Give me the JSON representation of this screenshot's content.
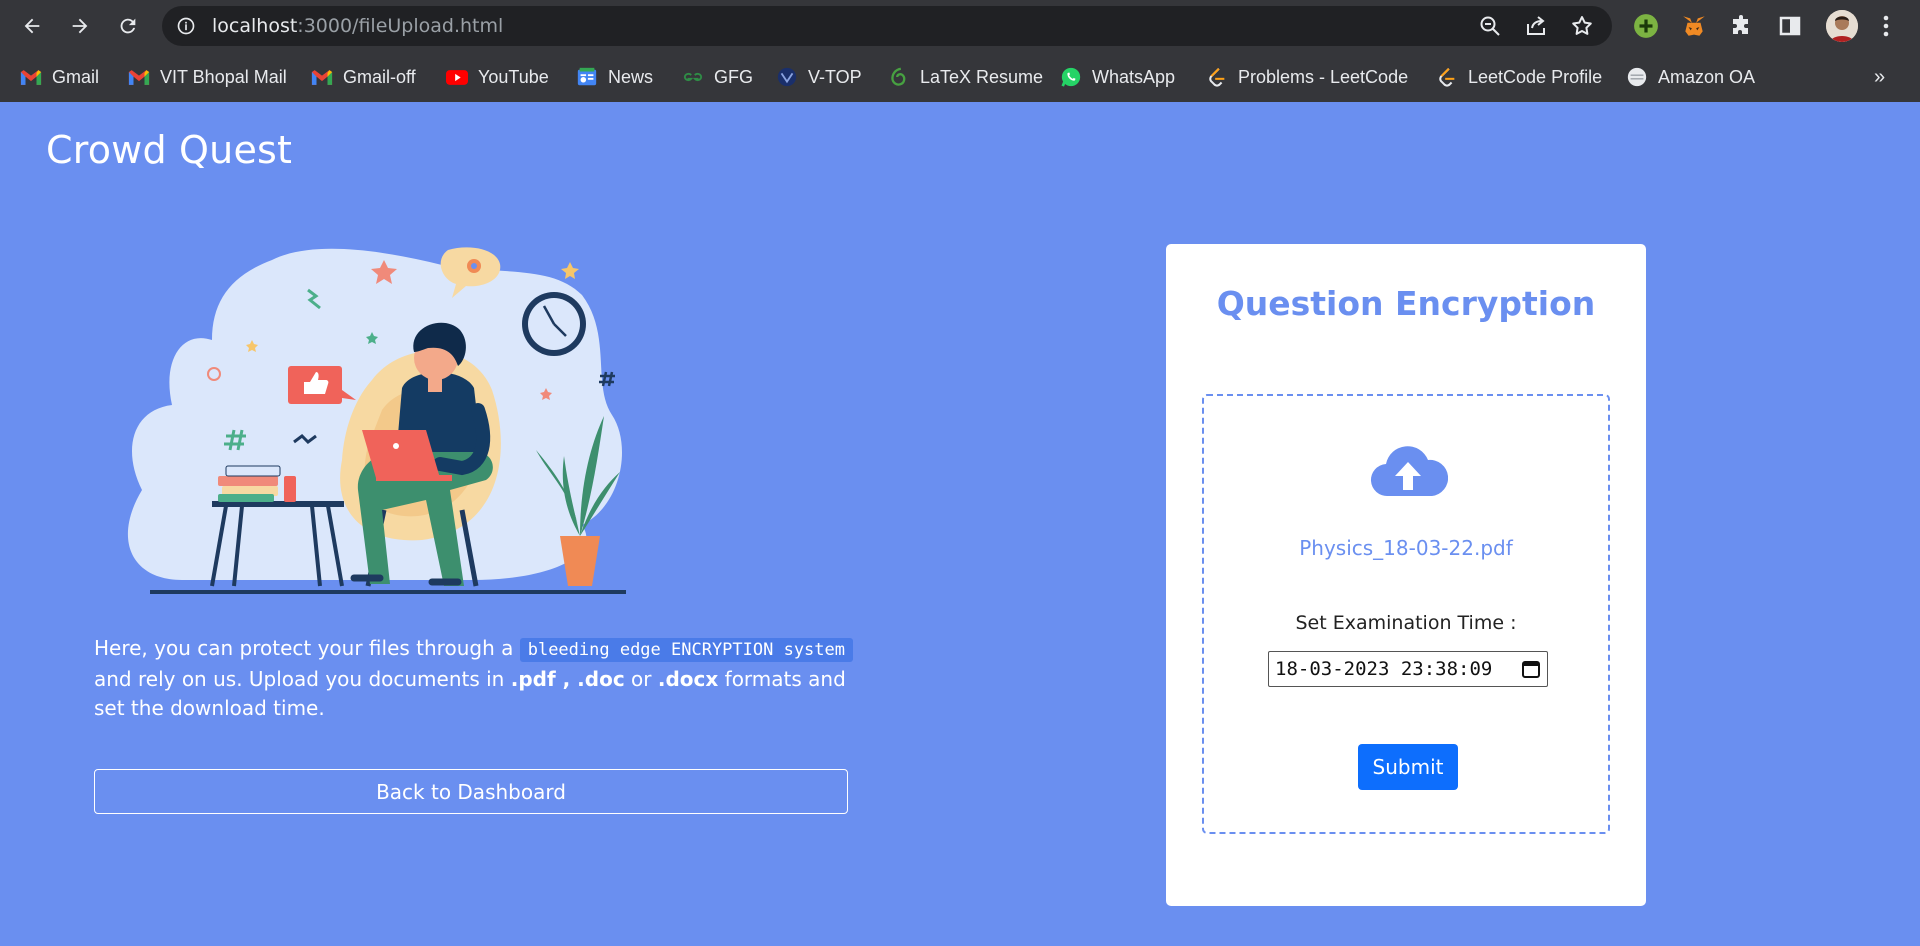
{
  "browser": {
    "url_host": "localhost",
    "url_path": ":3000/fileUpload.html",
    "bookmarks": [
      {
        "label": "Gmail",
        "icon": "gmail-icon"
      },
      {
        "label": "VIT Bhopal Mail",
        "icon": "gmail-icon"
      },
      {
        "label": "Gmail-off",
        "icon": "gmail-icon"
      },
      {
        "label": "YouTube",
        "icon": "youtube-icon"
      },
      {
        "label": "News",
        "icon": "google-news-icon"
      },
      {
        "label": "GFG",
        "icon": "geeksforgeeks-icon"
      },
      {
        "label": "V-TOP",
        "icon": "vtop-icon"
      },
      {
        "label": "LaTeX Resume",
        "icon": "overleaf-icon"
      },
      {
        "label": "WhatsApp",
        "icon": "whatsapp-icon"
      },
      {
        "label": "Problems - LeetCode",
        "icon": "leetcode-icon"
      },
      {
        "label": "LeetCode Profile",
        "icon": "leetcode-icon"
      },
      {
        "label": "Amazon OA",
        "icon": "globe-icon"
      }
    ],
    "more_bookmarks": "»"
  },
  "page": {
    "brand": "Crowd Quest",
    "description": {
      "part1": "Here, you can protect your files through a ",
      "code": "bleeding edge ENCRYPTION system",
      "part2": " and rely on us. Upload you documents in ",
      "fmt1": ".pdf , .doc",
      "part3": " or ",
      "fmt2": ".docx",
      "part4": " formats and set the download time."
    },
    "back_button": "Back to Dashboard"
  },
  "card": {
    "title": "Question Encryption",
    "file_name": "Physics_18-03-22.pdf",
    "time_label": "Set Examination Time :",
    "datetime_value": "18-03-2023 23:38:09",
    "submit": "Submit"
  },
  "colors": {
    "page_bg": "#6a8ff0",
    "accent": "#6a8ff0",
    "submit_bg": "#0d6efd",
    "chrome_bg": "#35363a"
  }
}
